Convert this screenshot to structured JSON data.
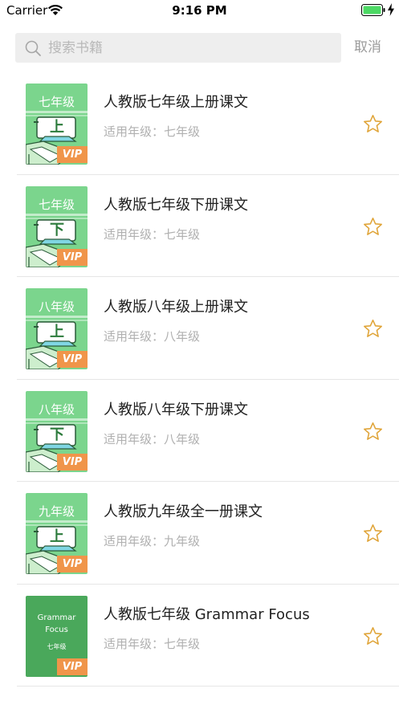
{
  "status_bar": {
    "carrier": "Carrier",
    "time": "9:16 PM"
  },
  "search": {
    "placeholder": "搜索书籍",
    "value": "",
    "cancel_label": "取消"
  },
  "colors": {
    "accent_star": "#e0a53a",
    "cover_green": "#7bd58d",
    "cover_dark_green": "#4aa85b",
    "vip_orange": "#f0954a",
    "battery_green": "#4cd964"
  },
  "books": [
    {
      "title": "人教版七年级上册课文",
      "grade": "适用年级：七年级",
      "cover_grade": "七年级",
      "cover_char": "上",
      "badge": "VIP",
      "cover_style": "illustration"
    },
    {
      "title": "人教版七年级下册课文",
      "grade": "适用年级：七年级",
      "cover_grade": "七年级",
      "cover_char": "下",
      "badge": "VIP",
      "cover_style": "illustration"
    },
    {
      "title": "人教版八年级上册课文",
      "grade": "适用年级：八年级",
      "cover_grade": "八年级",
      "cover_char": "上",
      "badge": "VIP",
      "cover_style": "illustration"
    },
    {
      "title": "人教版八年级下册课文",
      "grade": "适用年级：八年级",
      "cover_grade": "八年级",
      "cover_char": "下",
      "badge": "VIP",
      "cover_style": "illustration"
    },
    {
      "title": "人教版九年级全一册课文",
      "grade": "适用年级：九年级",
      "cover_grade": "九年级",
      "cover_char": "上",
      "badge": "VIP",
      "cover_style": "illustration"
    },
    {
      "title": "人教版七年级 Grammar Focus",
      "grade": "适用年级：七年级",
      "cover_title": "Grammar Focus",
      "cover_grade": "七年级",
      "badge": "VIP",
      "cover_style": "grammar"
    }
  ]
}
